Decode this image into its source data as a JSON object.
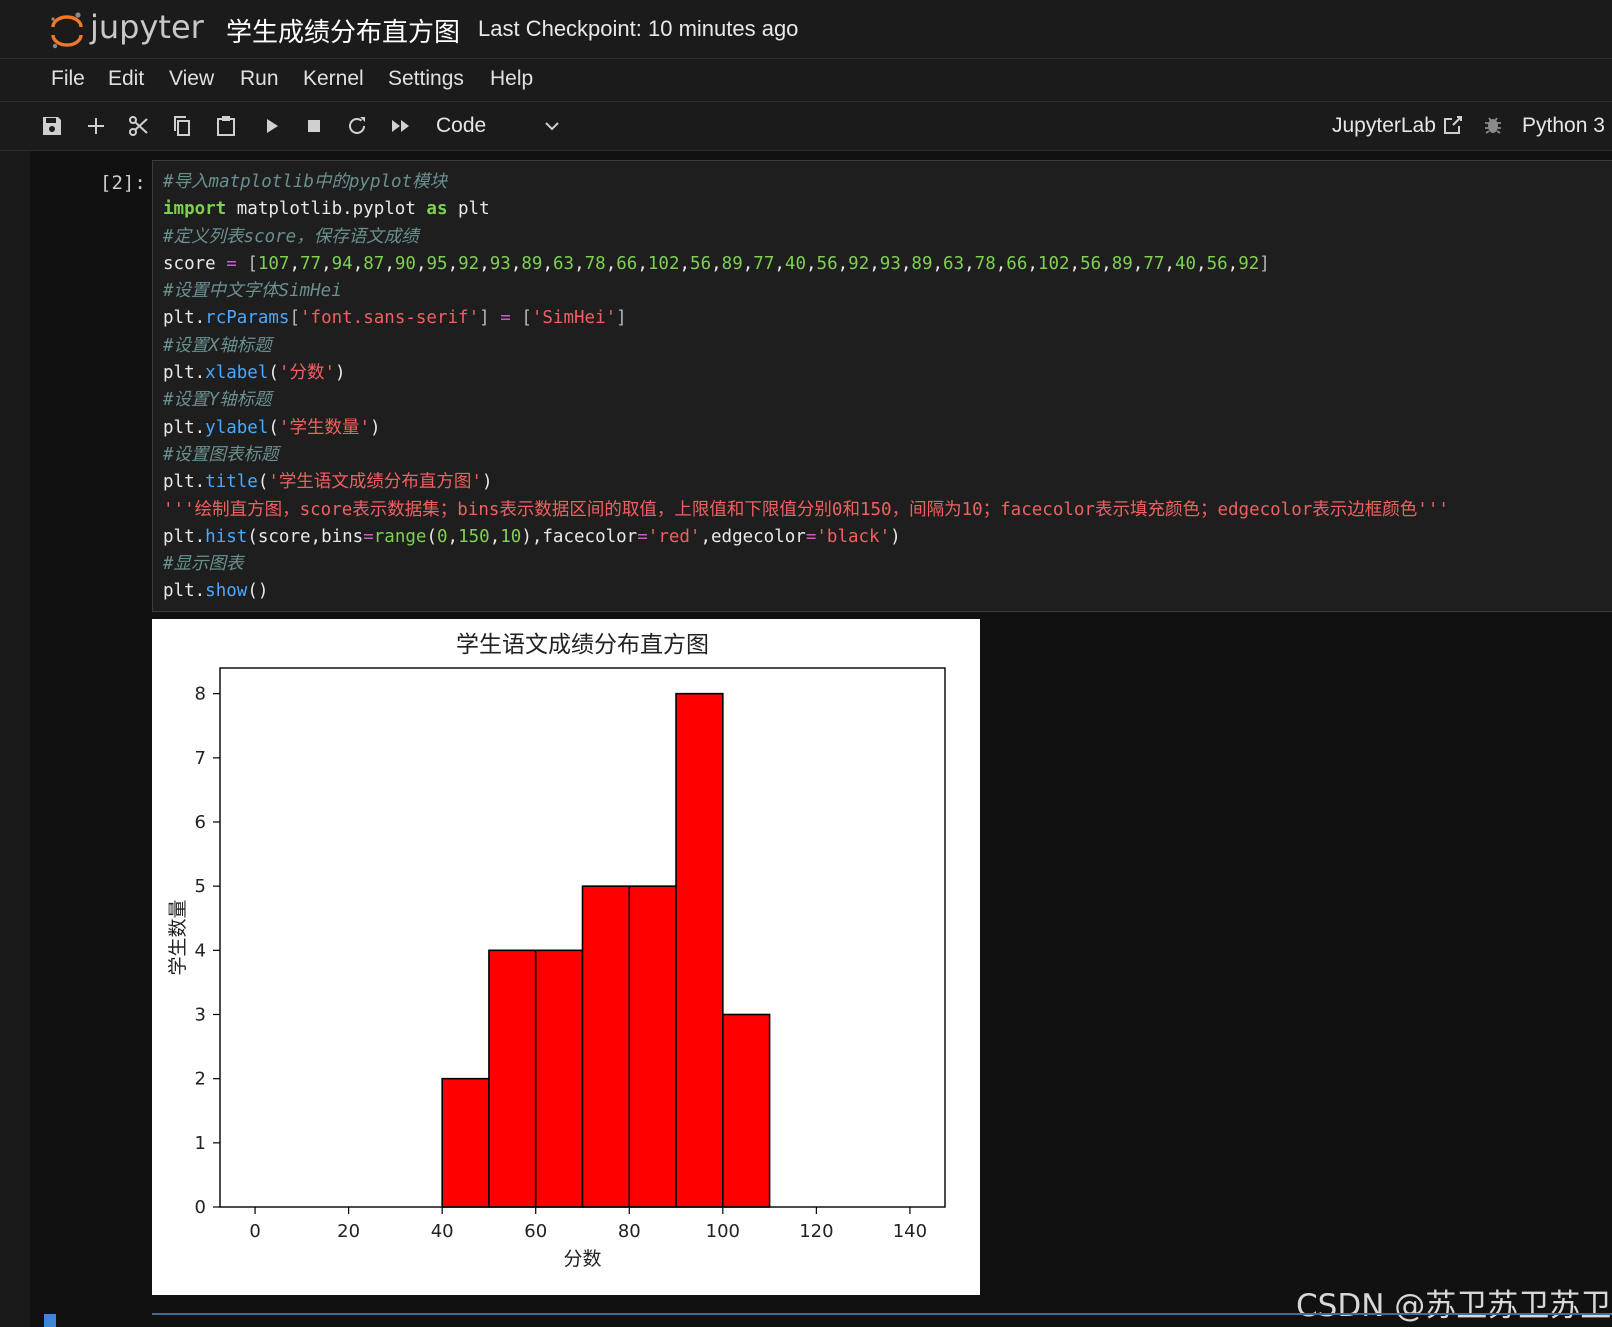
{
  "header": {
    "brand": "jupyter",
    "notebook_title": "学生成绩分布直方图",
    "checkpoint": "Last Checkpoint: 10 minutes ago"
  },
  "menu": [
    "File",
    "Edit",
    "View",
    "Run",
    "Kernel",
    "Settings",
    "Help"
  ],
  "toolbar": {
    "cell_type": "Code",
    "jupyterlab_label": "JupyterLab",
    "kernel_name": "Python 3"
  },
  "cell": {
    "prompt": "[2]:",
    "lines": [
      [
        {
          "t": "#导入matplotlib中的pyplot模块",
          "c": "com"
        }
      ],
      [
        {
          "t": "import",
          "c": "kw"
        },
        {
          "t": " matplotlib.pyplot "
        },
        {
          "t": "as",
          "c": "kw"
        },
        {
          "t": " plt"
        }
      ],
      [
        {
          "t": "#定义列表score，保存语文成绩",
          "c": "com"
        }
      ],
      [
        {
          "t": "score "
        },
        {
          "t": "=",
          "c": "op"
        },
        {
          "t": " "
        },
        {
          "t": "[",
          "c": "brk"
        },
        {
          "t": "107",
          "c": "num"
        },
        {
          "t": ","
        },
        {
          "t": "77",
          "c": "num"
        },
        {
          "t": ","
        },
        {
          "t": "94",
          "c": "num"
        },
        {
          "t": ","
        },
        {
          "t": "87",
          "c": "num"
        },
        {
          "t": ","
        },
        {
          "t": "90",
          "c": "num"
        },
        {
          "t": ","
        },
        {
          "t": "95",
          "c": "num"
        },
        {
          "t": ","
        },
        {
          "t": "92",
          "c": "num"
        },
        {
          "t": ","
        },
        {
          "t": "93",
          "c": "num"
        },
        {
          "t": ","
        },
        {
          "t": "89",
          "c": "num"
        },
        {
          "t": ","
        },
        {
          "t": "63",
          "c": "num"
        },
        {
          "t": ","
        },
        {
          "t": "78",
          "c": "num"
        },
        {
          "t": ","
        },
        {
          "t": "66",
          "c": "num"
        },
        {
          "t": ","
        },
        {
          "t": "102",
          "c": "num"
        },
        {
          "t": ","
        },
        {
          "t": "56",
          "c": "num"
        },
        {
          "t": ","
        },
        {
          "t": "89",
          "c": "num"
        },
        {
          "t": ","
        },
        {
          "t": "77",
          "c": "num"
        },
        {
          "t": ","
        },
        {
          "t": "40",
          "c": "num"
        },
        {
          "t": ","
        },
        {
          "t": "56",
          "c": "num"
        },
        {
          "t": ","
        },
        {
          "t": "92",
          "c": "num"
        },
        {
          "t": ","
        },
        {
          "t": "93",
          "c": "num"
        },
        {
          "t": ","
        },
        {
          "t": "89",
          "c": "num"
        },
        {
          "t": ","
        },
        {
          "t": "63",
          "c": "num"
        },
        {
          "t": ","
        },
        {
          "t": "78",
          "c": "num"
        },
        {
          "t": ","
        },
        {
          "t": "66",
          "c": "num"
        },
        {
          "t": ","
        },
        {
          "t": "102",
          "c": "num"
        },
        {
          "t": ","
        },
        {
          "t": "56",
          "c": "num"
        },
        {
          "t": ","
        },
        {
          "t": "89",
          "c": "num"
        },
        {
          "t": ","
        },
        {
          "t": "77",
          "c": "num"
        },
        {
          "t": ","
        },
        {
          "t": "40",
          "c": "num"
        },
        {
          "t": ","
        },
        {
          "t": "56",
          "c": "num"
        },
        {
          "t": ","
        },
        {
          "t": "92",
          "c": "num"
        },
        {
          "t": "]",
          "c": "brk"
        }
      ],
      [
        {
          "t": "#设置中文字体SimHei",
          "c": "com"
        }
      ],
      [
        {
          "t": "plt."
        },
        {
          "t": "rcParams",
          "c": "attr"
        },
        {
          "t": "[",
          "c": "brk"
        },
        {
          "t": "'font.sans-serif'",
          "c": "str"
        },
        {
          "t": "]",
          "c": "brk"
        },
        {
          "t": " "
        },
        {
          "t": "=",
          "c": "op"
        },
        {
          "t": " "
        },
        {
          "t": "[",
          "c": "brk"
        },
        {
          "t": "'SimHei'",
          "c": "str"
        },
        {
          "t": "]",
          "c": "brk"
        }
      ],
      [
        {
          "t": "#设置X轴标题",
          "c": "com"
        }
      ],
      [
        {
          "t": "plt."
        },
        {
          "t": "xlabel",
          "c": "attr"
        },
        {
          "t": "("
        },
        {
          "t": "'分数'",
          "c": "str"
        },
        {
          "t": ")"
        }
      ],
      [
        {
          "t": "#设置Y轴标题",
          "c": "com"
        }
      ],
      [
        {
          "t": "plt."
        },
        {
          "t": "ylabel",
          "c": "attr"
        },
        {
          "t": "("
        },
        {
          "t": "'学生数量'",
          "c": "str"
        },
        {
          "t": ")"
        }
      ],
      [
        {
          "t": "#设置图表标题",
          "c": "com"
        }
      ],
      [
        {
          "t": "plt."
        },
        {
          "t": "title",
          "c": "attr"
        },
        {
          "t": "("
        },
        {
          "t": "'学生语文成绩分布直方图'",
          "c": "str"
        },
        {
          "t": ")"
        }
      ],
      [
        {
          "t": "'''绘制直方图，score表示数据集；bins表示数据区间的取值，上限值和下限值分别0和150，间隔为10；facecolor表示填充颜色；edgecolor表示边框颜色'''",
          "c": "str"
        }
      ],
      [
        {
          "t": "plt."
        },
        {
          "t": "hist",
          "c": "attr"
        },
        {
          "t": "(score,bins"
        },
        {
          "t": "=",
          "c": "op"
        },
        {
          "t": "range",
          "c": "num"
        },
        {
          "t": "("
        },
        {
          "t": "0",
          "c": "num"
        },
        {
          "t": ","
        },
        {
          "t": "150",
          "c": "num"
        },
        {
          "t": ","
        },
        {
          "t": "10",
          "c": "num"
        },
        {
          "t": "),facecolor"
        },
        {
          "t": "=",
          "c": "op"
        },
        {
          "t": "'red'",
          "c": "str"
        },
        {
          "t": ",edgecolor"
        },
        {
          "t": "=",
          "c": "op"
        },
        {
          "t": "'black'",
          "c": "str"
        },
        {
          "t": ")"
        }
      ],
      [
        {
          "t": "#显示图表",
          "c": "com"
        }
      ],
      [
        {
          "t": "plt."
        },
        {
          "t": "show",
          "c": "attr"
        },
        {
          "t": "()"
        }
      ]
    ]
  },
  "chart_data": {
    "type": "bar",
    "title": "学生语文成绩分布直方图",
    "xlabel": "分数",
    "ylabel": "学生数量",
    "bin_edges": [
      0,
      10,
      20,
      30,
      40,
      50,
      60,
      70,
      80,
      90,
      100,
      110,
      120,
      130,
      140,
      150
    ],
    "values": [
      0,
      0,
      0,
      0,
      2,
      4,
      4,
      5,
      5,
      8,
      3,
      0,
      0,
      0,
      0
    ],
    "xlim": [
      -7.5,
      147.5
    ],
    "ylim": [
      0,
      8.4
    ],
    "xticks": [
      0,
      20,
      40,
      60,
      80,
      100,
      120,
      140
    ],
    "yticks": [
      0,
      1,
      2,
      3,
      4,
      5,
      6,
      7,
      8
    ],
    "facecolor": "#ff0000",
    "edgecolor": "#000000",
    "grid": false
  },
  "watermark": "CSDN @苏卫苏卫苏卫"
}
